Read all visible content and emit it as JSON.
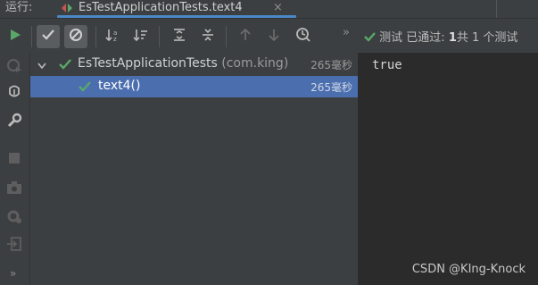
{
  "runbar": {
    "label": "运行:",
    "tab_title": "EsTestApplicationTests.text4",
    "close_glyph": "×"
  },
  "toolbar": {
    "more_glyph": "»",
    "status_prefix": "测试",
    "status_passed": "已通过:",
    "status_count": "1",
    "status_suffix": "共 1 个测试"
  },
  "tree": {
    "root": {
      "name": "EsTestApplicationTests",
      "package": "(com.king)",
      "time": "265毫秒",
      "status": "passed"
    },
    "children": [
      {
        "name": "text4()",
        "time": "265毫秒",
        "status": "passed",
        "selected": true
      }
    ]
  },
  "output": {
    "lines": [
      "true"
    ]
  },
  "watermark": "CSDN @KIng-Knock",
  "left_strip_more": "»",
  "colors": {
    "pass_green": "#59a869",
    "run_green": "#59a869",
    "selection": "#4b6eaf",
    "tab_underline": "#4a88c7"
  }
}
